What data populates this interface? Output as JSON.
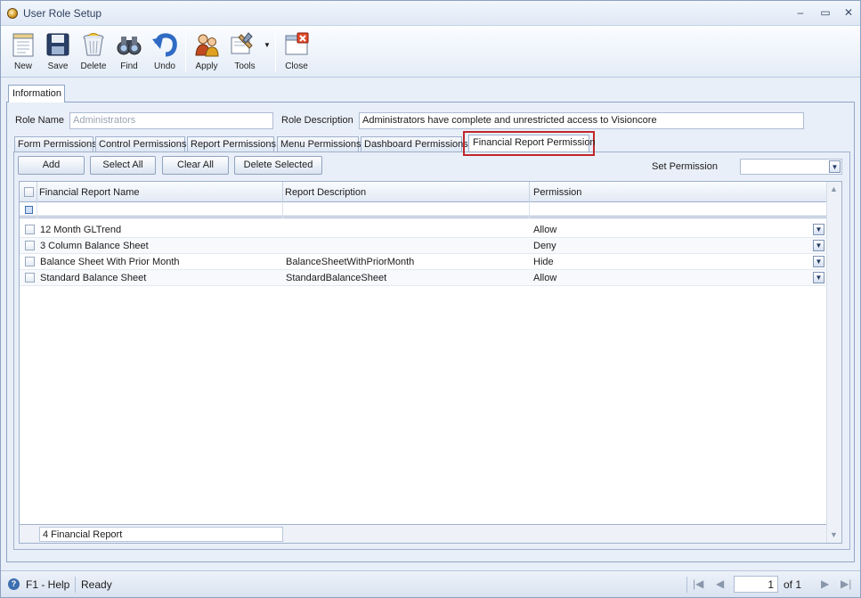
{
  "window": {
    "title": "User Role Setup",
    "controls": [
      "–",
      "▭",
      "✕"
    ]
  },
  "toolbar": {
    "new": "New",
    "save": "Save",
    "delete": "Delete",
    "find": "Find",
    "undo": "Undo",
    "apply": "Apply",
    "tools": "Tools",
    "close": "Close"
  },
  "main_tab": "Information",
  "form": {
    "role_name_label": "Role Name",
    "role_name_value": "Administrators",
    "role_description_label": "Role Description",
    "role_description_value": "Administrators have complete and unrestricted access to Visioncore"
  },
  "subtabs": [
    "Form Permissions",
    "Control Permissions",
    "Report Permissions",
    "Menu Permissions",
    "Dashboard Permissions",
    "Financial Report Permission"
  ],
  "actions": {
    "add": "Add",
    "select_all": "Select All",
    "clear_all": "Clear All",
    "delete_selected": "Delete Selected"
  },
  "set_permission": {
    "label": "Set Permission",
    "value": ""
  },
  "grid": {
    "columns": [
      "Financial Report Name",
      "Report Description",
      "Permission"
    ],
    "rows": [
      {
        "name": "12 Month GLTrend",
        "description": "",
        "permission": "Allow"
      },
      {
        "name": "3 Column Balance Sheet",
        "description": "",
        "permission": "Deny"
      },
      {
        "name": "Balance Sheet With Prior Month",
        "description": "BalanceSheetWithPriorMonth",
        "permission": "Hide"
      },
      {
        "name": "Standard Balance Sheet",
        "description": "StandardBalanceSheet",
        "permission": "Allow"
      }
    ],
    "footer": "4 Financial Report"
  },
  "status": {
    "help": "F1 - Help",
    "state": "Ready",
    "page": "1",
    "of_label": "of 1"
  },
  "colors": {
    "active_tab_highlight": "#c0262b",
    "accent": "#3d6fb0"
  }
}
